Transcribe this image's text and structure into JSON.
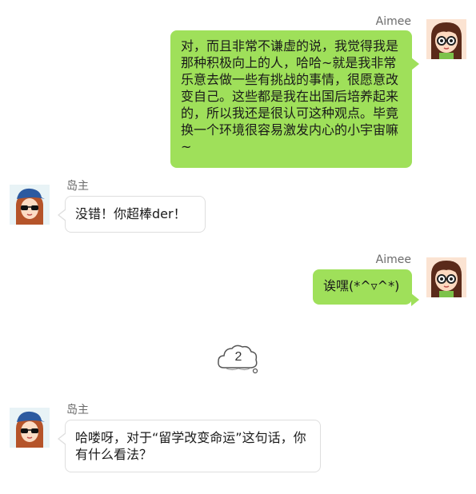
{
  "messages": [
    {
      "sender": "Aimee",
      "side": "right",
      "text": "对，而且非常不谦虚的说，我觉得我是那种积极向上的人，哈哈~就是我非常乐意去做一些有挑战的事情，很愿意改变自己。这些都是我在出国后培养起来的，所以我还是很认可这种观点。毕竟换一个环境很容易激发内心的小宇宙嘛~"
    },
    {
      "sender": "岛主",
      "side": "left",
      "text": "没错！你超棒der！"
    },
    {
      "sender": "Aimee",
      "side": "right",
      "text": "诶嘿(*^▿^*)"
    },
    {
      "sender": "岛主",
      "side": "left",
      "text": "哈喽呀，对于“留学改变命运”这句话，你有什么看法？"
    }
  ],
  "divider": {
    "label": "2"
  },
  "colors": {
    "my_bubble": "#9fe05a",
    "their_border": "#dedede",
    "name_text": "#6b6b6b"
  }
}
